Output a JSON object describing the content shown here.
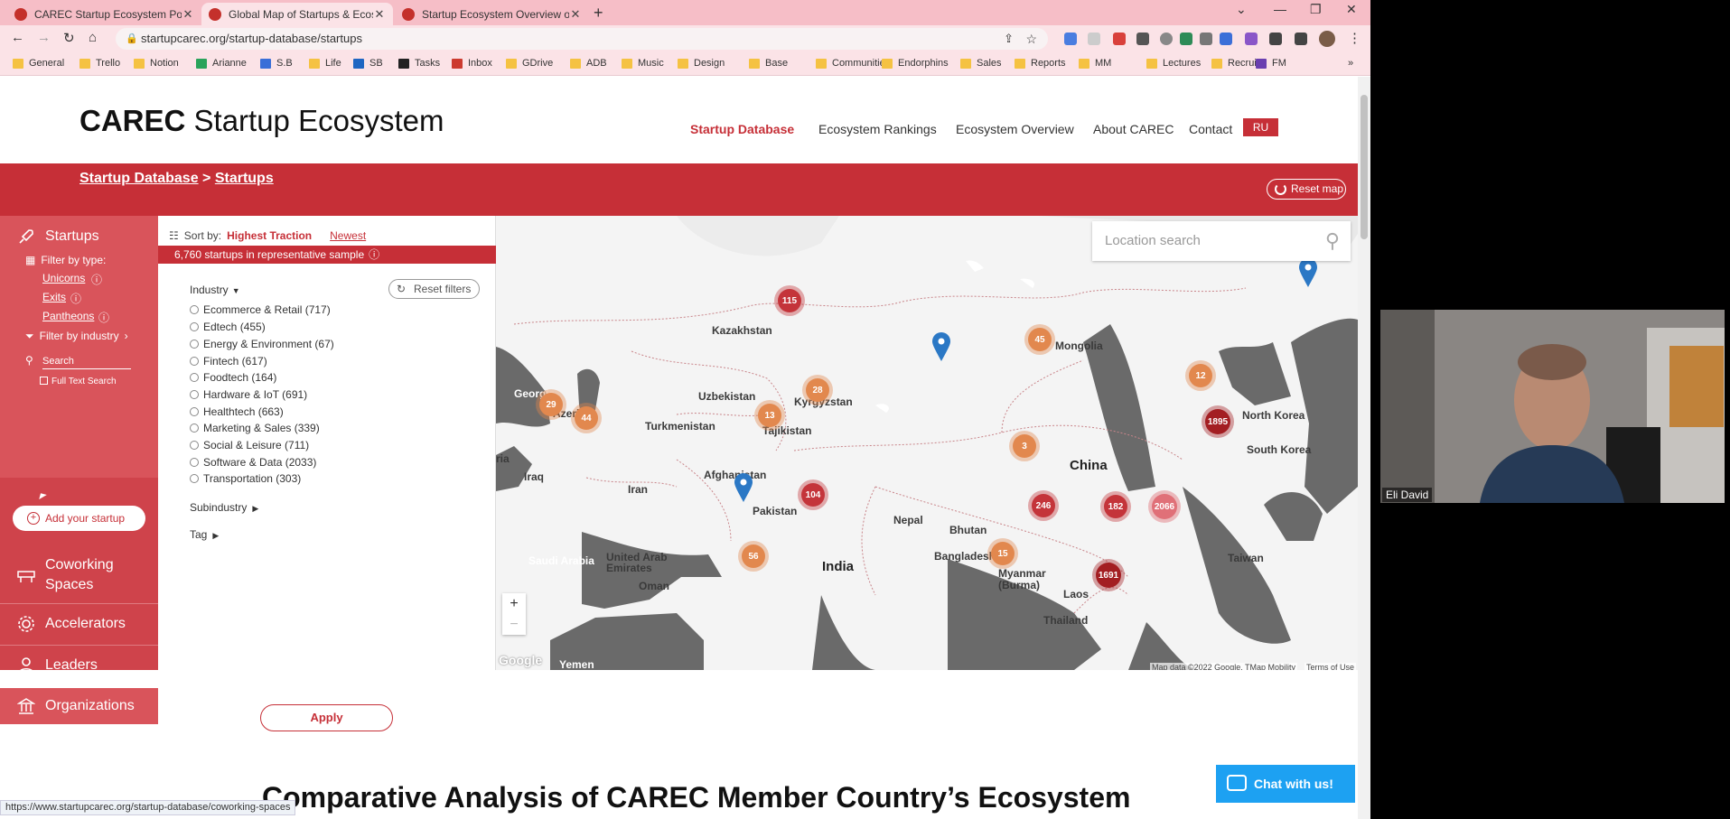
{
  "browser": {
    "tabs": [
      {
        "title": "CAREC Startup Ecosystem Portal"
      },
      {
        "title": "Global Map of Startups & Ecosys"
      },
      {
        "title": "Startup Ecosystem Overview of K"
      }
    ],
    "url": "startupcarec.org/startup-database/startups",
    "bookmarks": [
      "General",
      "Trello",
      "Notion",
      "Arianne",
      "S.B",
      "Life",
      "SB",
      "Tasks",
      "Inbox",
      "GDrive",
      "ADB",
      "Music",
      "Design",
      "Base",
      "Communities",
      "Endorphins",
      "Sales",
      "Reports",
      "MM",
      "Lectures",
      "Recruit",
      "FM"
    ],
    "status_url": "https://www.startupcarec.org/startup-database/coworking-spaces"
  },
  "site": {
    "logo_bold": "CAREC",
    "logo_rest": " Startup Ecosystem",
    "nav": [
      "Startup Database",
      "Ecosystem Rankings",
      "Ecosystem Overview",
      "About CAREC",
      "Contact"
    ],
    "lang": "RU",
    "breadcrumb_1": "Startup Database",
    "breadcrumb_sep": " > ",
    "breadcrumb_2": "Startups",
    "reset_map": "Reset map"
  },
  "sidebar": {
    "startups": "Startups",
    "filter_by_type": "Filter by type:",
    "unicorns": "Unicorns",
    "exits": "Exits",
    "pantheons": "Pantheons",
    "filter_by_industry": "Filter by industry",
    "search_placeholder": "Search",
    "full_text_search": "Full Text Search",
    "add_startup": "Add your startup",
    "coworking": "Coworking Spaces",
    "accelerators": "Accelerators",
    "leaders": "Leaders",
    "organizations": "Organizations"
  },
  "filters": {
    "sort_by": "Sort by:",
    "sort_highest": "Highest Traction",
    "sort_newest": "Newest",
    "count_text": "6,760 startups in representative sample",
    "industry": "Industry",
    "reset_filters": "Reset filters",
    "options": [
      "Ecommerce & Retail (717)",
      "Edtech (455)",
      "Energy & Environment (67)",
      "Fintech (617)",
      "Foodtech (164)",
      "Hardware & IoT (691)",
      "Healthtech (663)",
      "Marketing & Sales (339)",
      "Social & Leisure (711)",
      "Software & Data (2033)",
      "Transportation (303)"
    ],
    "subindustry": "Subindustry",
    "tag": "Tag",
    "apply": "Apply"
  },
  "map": {
    "location_placeholder": "Location search",
    "zoom_in": "+",
    "zoom_out": "−",
    "attribution": "Map data ©2022 Google, TMap Mobility",
    "terms": "Terms of Use",
    "google": "Google",
    "countries": [
      "Kazakhstan",
      "Mongolia",
      "Georgia",
      "Azerb",
      "Uzbekistan",
      "Kyrgyzstan",
      "Turkmenistan",
      "Tajikistan",
      "North Korea",
      "South Korea",
      "China",
      "Iraq",
      "Iran",
      "Afghanistan",
      "Pakistan",
      "Nepal",
      "Bhutan",
      "Bangladesh",
      "India",
      "United Arab Emirates",
      "Oman",
      "Saudi Arabia",
      "Yemen",
      "Myanmar (Burma)",
      "Laos",
      "Thailand",
      "Taiwan",
      "ria"
    ],
    "clusters": [
      "115",
      "45",
      "12",
      "29",
      "44",
      "28",
      "13",
      "1895",
      "3",
      "104",
      "246",
      "182",
      "2066",
      "56",
      "15",
      "1691"
    ]
  },
  "page": {
    "heading2": "Comparative Analysis of CAREC Member Country’s Ecosystem",
    "chat": "Chat with us!"
  },
  "video": {
    "name": "Eli David"
  },
  "colors": {
    "brand_red": "#c62f37",
    "tab_pink": "#f6bec7",
    "chat_blue": "#1da1f2"
  }
}
